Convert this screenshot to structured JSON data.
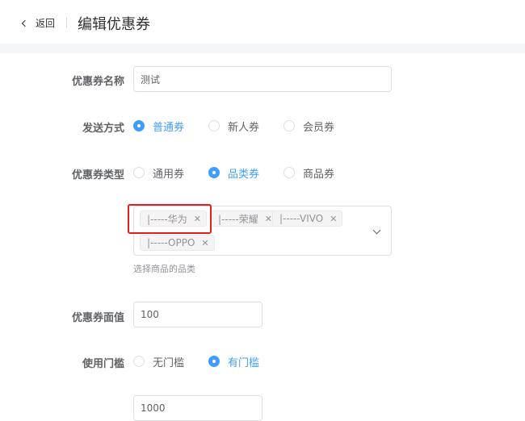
{
  "header": {
    "back_label": "返回",
    "title": "编辑优惠券"
  },
  "form": {
    "name": {
      "label": "优惠券名称",
      "value": "测试"
    },
    "send_method": {
      "label": "发送方式",
      "options": [
        {
          "label": "普通券",
          "checked": true
        },
        {
          "label": "新人券",
          "checked": false
        },
        {
          "label": "会员券",
          "checked": false
        }
      ]
    },
    "coupon_type": {
      "label": "优惠券类型",
      "options": [
        {
          "label": "通用券",
          "checked": false
        },
        {
          "label": "品类券",
          "checked": true
        },
        {
          "label": "商品券",
          "checked": false
        }
      ]
    },
    "category_select": {
      "tags": [
        "|-----华为",
        "|-----荣耀",
        "|-----VIVO",
        "|-----OPPO"
      ],
      "hint": "选择商品的品类"
    },
    "face_value": {
      "label": "优惠券面值",
      "value": "100"
    },
    "threshold": {
      "label": "使用门槛",
      "options": [
        {
          "label": "无门槛",
          "checked": false
        },
        {
          "label": "有门槛",
          "checked": true
        }
      ],
      "value": "1000"
    }
  },
  "colors": {
    "accent": "#409eff",
    "highlight_box": "#e0201e"
  }
}
